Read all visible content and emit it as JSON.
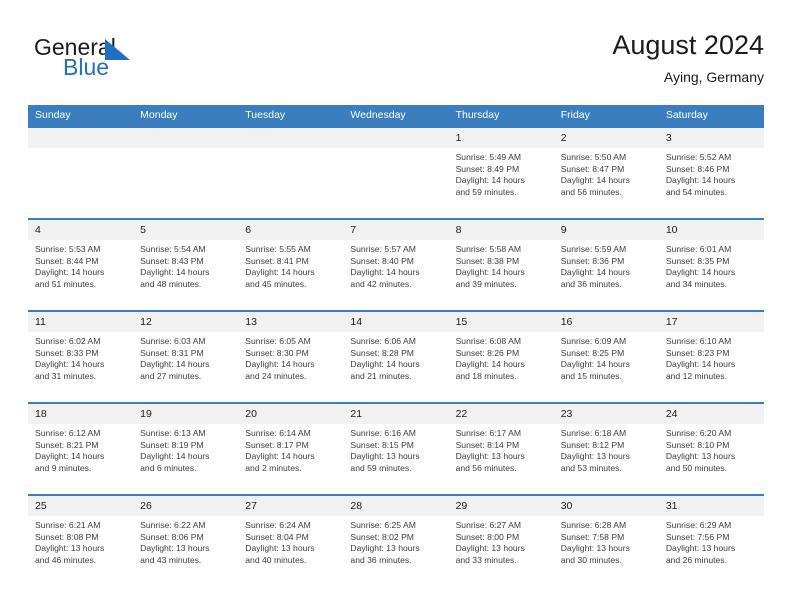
{
  "brand": {
    "name_part1": "General",
    "name_part2": "Blue",
    "flag_icon": "triangle-flag-icon",
    "accent_color": "#1f6fc4"
  },
  "header": {
    "title": "August 2024",
    "location": "Aying, Germany"
  },
  "calendar": {
    "header_bg_color": "#3a7ec0",
    "daynum_bg_color": "#f1f1f1",
    "weekday_headers": [
      "Sunday",
      "Monday",
      "Tuesday",
      "Wednesday",
      "Thursday",
      "Friday",
      "Saturday"
    ],
    "weeks": [
      [
        {
          "day": "",
          "blank": true,
          "sunrise": "",
          "sunset": "",
          "daylight1": "",
          "daylight2": ""
        },
        {
          "day": "",
          "blank": true,
          "sunrise": "",
          "sunset": "",
          "daylight1": "",
          "daylight2": ""
        },
        {
          "day": "",
          "blank": true,
          "sunrise": "",
          "sunset": "",
          "daylight1": "",
          "daylight2": ""
        },
        {
          "day": "",
          "blank": true,
          "sunrise": "",
          "sunset": "",
          "daylight1": "",
          "daylight2": ""
        },
        {
          "day": "1",
          "blank": false,
          "sunrise": "Sunrise: 5:49 AM",
          "sunset": "Sunset: 8:49 PM",
          "daylight1": "Daylight: 14 hours",
          "daylight2": "and 59 minutes."
        },
        {
          "day": "2",
          "blank": false,
          "sunrise": "Sunrise: 5:50 AM",
          "sunset": "Sunset: 8:47 PM",
          "daylight1": "Daylight: 14 hours",
          "daylight2": "and 56 minutes."
        },
        {
          "day": "3",
          "blank": false,
          "sunrise": "Sunrise: 5:52 AM",
          "sunset": "Sunset: 8:46 PM",
          "daylight1": "Daylight: 14 hours",
          "daylight2": "and 54 minutes."
        }
      ],
      [
        {
          "day": "4",
          "blank": false,
          "sunrise": "Sunrise: 5:53 AM",
          "sunset": "Sunset: 8:44 PM",
          "daylight1": "Daylight: 14 hours",
          "daylight2": "and 51 minutes."
        },
        {
          "day": "5",
          "blank": false,
          "sunrise": "Sunrise: 5:54 AM",
          "sunset": "Sunset: 8:43 PM",
          "daylight1": "Daylight: 14 hours",
          "daylight2": "and 48 minutes."
        },
        {
          "day": "6",
          "blank": false,
          "sunrise": "Sunrise: 5:55 AM",
          "sunset": "Sunset: 8:41 PM",
          "daylight1": "Daylight: 14 hours",
          "daylight2": "and 45 minutes."
        },
        {
          "day": "7",
          "blank": false,
          "sunrise": "Sunrise: 5:57 AM",
          "sunset": "Sunset: 8:40 PM",
          "daylight1": "Daylight: 14 hours",
          "daylight2": "and 42 minutes."
        },
        {
          "day": "8",
          "blank": false,
          "sunrise": "Sunrise: 5:58 AM",
          "sunset": "Sunset: 8:38 PM",
          "daylight1": "Daylight: 14 hours",
          "daylight2": "and 39 minutes."
        },
        {
          "day": "9",
          "blank": false,
          "sunrise": "Sunrise: 5:59 AM",
          "sunset": "Sunset: 8:36 PM",
          "daylight1": "Daylight: 14 hours",
          "daylight2": "and 36 minutes."
        },
        {
          "day": "10",
          "blank": false,
          "sunrise": "Sunrise: 6:01 AM",
          "sunset": "Sunset: 8:35 PM",
          "daylight1": "Daylight: 14 hours",
          "daylight2": "and 34 minutes."
        }
      ],
      [
        {
          "day": "11",
          "blank": false,
          "sunrise": "Sunrise: 6:02 AM",
          "sunset": "Sunset: 8:33 PM",
          "daylight1": "Daylight: 14 hours",
          "daylight2": "and 31 minutes."
        },
        {
          "day": "12",
          "blank": false,
          "sunrise": "Sunrise: 6:03 AM",
          "sunset": "Sunset: 8:31 PM",
          "daylight1": "Daylight: 14 hours",
          "daylight2": "and 27 minutes."
        },
        {
          "day": "13",
          "blank": false,
          "sunrise": "Sunrise: 6:05 AM",
          "sunset": "Sunset: 8:30 PM",
          "daylight1": "Daylight: 14 hours",
          "daylight2": "and 24 minutes."
        },
        {
          "day": "14",
          "blank": false,
          "sunrise": "Sunrise: 6:06 AM",
          "sunset": "Sunset: 8:28 PM",
          "daylight1": "Daylight: 14 hours",
          "daylight2": "and 21 minutes."
        },
        {
          "day": "15",
          "blank": false,
          "sunrise": "Sunrise: 6:08 AM",
          "sunset": "Sunset: 8:26 PM",
          "daylight1": "Daylight: 14 hours",
          "daylight2": "and 18 minutes."
        },
        {
          "day": "16",
          "blank": false,
          "sunrise": "Sunrise: 6:09 AM",
          "sunset": "Sunset: 8:25 PM",
          "daylight1": "Daylight: 14 hours",
          "daylight2": "and 15 minutes."
        },
        {
          "day": "17",
          "blank": false,
          "sunrise": "Sunrise: 6:10 AM",
          "sunset": "Sunset: 8:23 PM",
          "daylight1": "Daylight: 14 hours",
          "daylight2": "and 12 minutes."
        }
      ],
      [
        {
          "day": "18",
          "blank": false,
          "sunrise": "Sunrise: 6:12 AM",
          "sunset": "Sunset: 8:21 PM",
          "daylight1": "Daylight: 14 hours",
          "daylight2": "and 9 minutes."
        },
        {
          "day": "19",
          "blank": false,
          "sunrise": "Sunrise: 6:13 AM",
          "sunset": "Sunset: 8:19 PM",
          "daylight1": "Daylight: 14 hours",
          "daylight2": "and 6 minutes."
        },
        {
          "day": "20",
          "blank": false,
          "sunrise": "Sunrise: 6:14 AM",
          "sunset": "Sunset: 8:17 PM",
          "daylight1": "Daylight: 14 hours",
          "daylight2": "and 2 minutes."
        },
        {
          "day": "21",
          "blank": false,
          "sunrise": "Sunrise: 6:16 AM",
          "sunset": "Sunset: 8:15 PM",
          "daylight1": "Daylight: 13 hours",
          "daylight2": "and 59 minutes."
        },
        {
          "day": "22",
          "blank": false,
          "sunrise": "Sunrise: 6:17 AM",
          "sunset": "Sunset: 8:14 PM",
          "daylight1": "Daylight: 13 hours",
          "daylight2": "and 56 minutes."
        },
        {
          "day": "23",
          "blank": false,
          "sunrise": "Sunrise: 6:18 AM",
          "sunset": "Sunset: 8:12 PM",
          "daylight1": "Daylight: 13 hours",
          "daylight2": "and 53 minutes."
        },
        {
          "day": "24",
          "blank": false,
          "sunrise": "Sunrise: 6:20 AM",
          "sunset": "Sunset: 8:10 PM",
          "daylight1": "Daylight: 13 hours",
          "daylight2": "and 50 minutes."
        }
      ],
      [
        {
          "day": "25",
          "blank": false,
          "sunrise": "Sunrise: 6:21 AM",
          "sunset": "Sunset: 8:08 PM",
          "daylight1": "Daylight: 13 hours",
          "daylight2": "and 46 minutes."
        },
        {
          "day": "26",
          "blank": false,
          "sunrise": "Sunrise: 6:22 AM",
          "sunset": "Sunset: 8:06 PM",
          "daylight1": "Daylight: 13 hours",
          "daylight2": "and 43 minutes."
        },
        {
          "day": "27",
          "blank": false,
          "sunrise": "Sunrise: 6:24 AM",
          "sunset": "Sunset: 8:04 PM",
          "daylight1": "Daylight: 13 hours",
          "daylight2": "and 40 minutes."
        },
        {
          "day": "28",
          "blank": false,
          "sunrise": "Sunrise: 6:25 AM",
          "sunset": "Sunset: 8:02 PM",
          "daylight1": "Daylight: 13 hours",
          "daylight2": "and 36 minutes."
        },
        {
          "day": "29",
          "blank": false,
          "sunrise": "Sunrise: 6:27 AM",
          "sunset": "Sunset: 8:00 PM",
          "daylight1": "Daylight: 13 hours",
          "daylight2": "and 33 minutes."
        },
        {
          "day": "30",
          "blank": false,
          "sunrise": "Sunrise: 6:28 AM",
          "sunset": "Sunset: 7:58 PM",
          "daylight1": "Daylight: 13 hours",
          "daylight2": "and 30 minutes."
        },
        {
          "day": "31",
          "blank": false,
          "sunrise": "Sunrise: 6:29 AM",
          "sunset": "Sunset: 7:56 PM",
          "daylight1": "Daylight: 13 hours",
          "daylight2": "and 26 minutes."
        }
      ]
    ]
  }
}
